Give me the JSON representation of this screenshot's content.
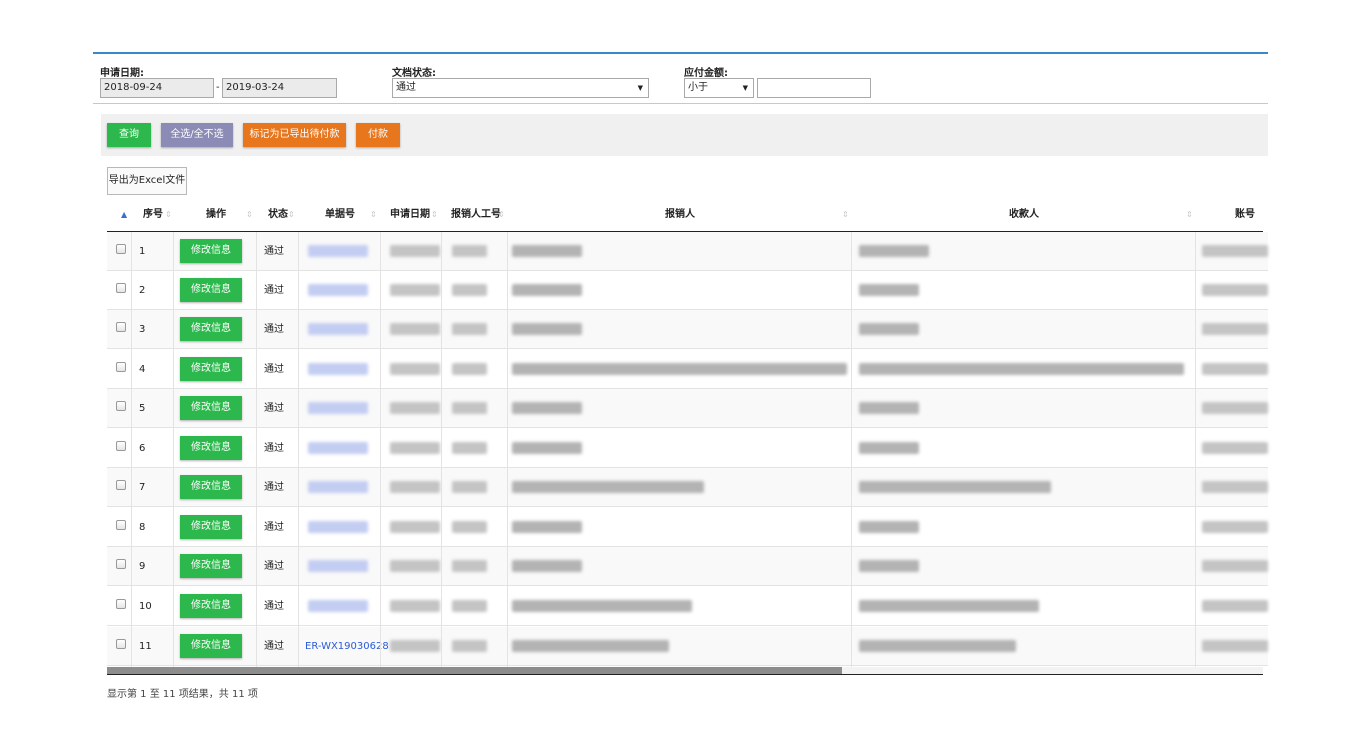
{
  "filters": {
    "date": {
      "label": "申请日期:",
      "start_value": "2018-09-24",
      "separator": "-",
      "end_value": "2019-03-24"
    },
    "status": {
      "label": "文档状态:",
      "selected": "通过"
    },
    "amount": {
      "label": "应付金额:",
      "operator": "小于",
      "value": ""
    }
  },
  "toolbar": {
    "query": "查询",
    "select_all": "全选/全不选",
    "mark_exported": "标记为已导出待付款",
    "pay": "付款"
  },
  "export_button": "导出为Excel文件",
  "columns": [
    "序号",
    "操作",
    "状态",
    "单据号",
    "申请日期",
    "报销人工号",
    "报销人",
    "收款人",
    "账号"
  ],
  "rows": [
    {
      "no": "1",
      "action": "修改信息",
      "status": "通过",
      "doc_no": ""
    },
    {
      "no": "2",
      "action": "修改信息",
      "status": "通过",
      "doc_no": ""
    },
    {
      "no": "3",
      "action": "修改信息",
      "status": "通过",
      "doc_no": ""
    },
    {
      "no": "4",
      "action": "修改信息",
      "status": "通过",
      "doc_no": ""
    },
    {
      "no": "5",
      "action": "修改信息",
      "status": "通过",
      "doc_no": ""
    },
    {
      "no": "6",
      "action": "修改信息",
      "status": "通过",
      "doc_no": ""
    },
    {
      "no": "7",
      "action": "修改信息",
      "status": "通过",
      "doc_no": ""
    },
    {
      "no": "8",
      "action": "修改信息",
      "status": "通过",
      "doc_no": ""
    },
    {
      "no": "9",
      "action": "修改信息",
      "status": "通过",
      "doc_no": ""
    },
    {
      "no": "10",
      "action": "修改信息",
      "status": "通过",
      "doc_no": ""
    },
    {
      "no": "11",
      "action": "修改信息",
      "status": "通过",
      "doc_no": "ER-WX19030628"
    }
  ],
  "pagination_info": "显示第 1 至 11 项结果，共 11 项",
  "colors": {
    "green": "#2db84d",
    "purple": "#8b8bb5",
    "orange": "#e8761c",
    "accent_rule": "#3a87c9",
    "link": "#2a5bd7"
  }
}
